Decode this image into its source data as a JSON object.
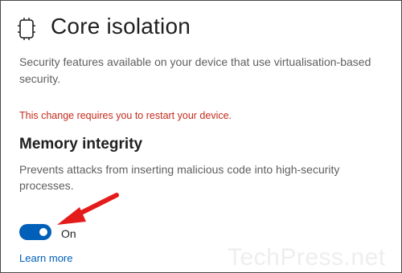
{
  "header": {
    "icon": "core-isolation-chip-icon",
    "title": "Core isolation"
  },
  "intro": {
    "description": "Security features available on your device that use virtualisation-based security."
  },
  "notice": {
    "text": "This change requires you to restart your device.",
    "color": "#c42b1c"
  },
  "memory_integrity": {
    "title": "Memory integrity",
    "description": "Prevents attacks from inserting malicious code into high-security processes.",
    "toggle_state": "On",
    "toggle_on": true,
    "toggle_color": "#005fb8",
    "learn_more_label": "Learn more"
  },
  "annotation": {
    "arrow_color": "#e41b1b",
    "arrow_icon": "red-arrow-icon"
  },
  "watermark": {
    "text": "TechPress.net"
  }
}
